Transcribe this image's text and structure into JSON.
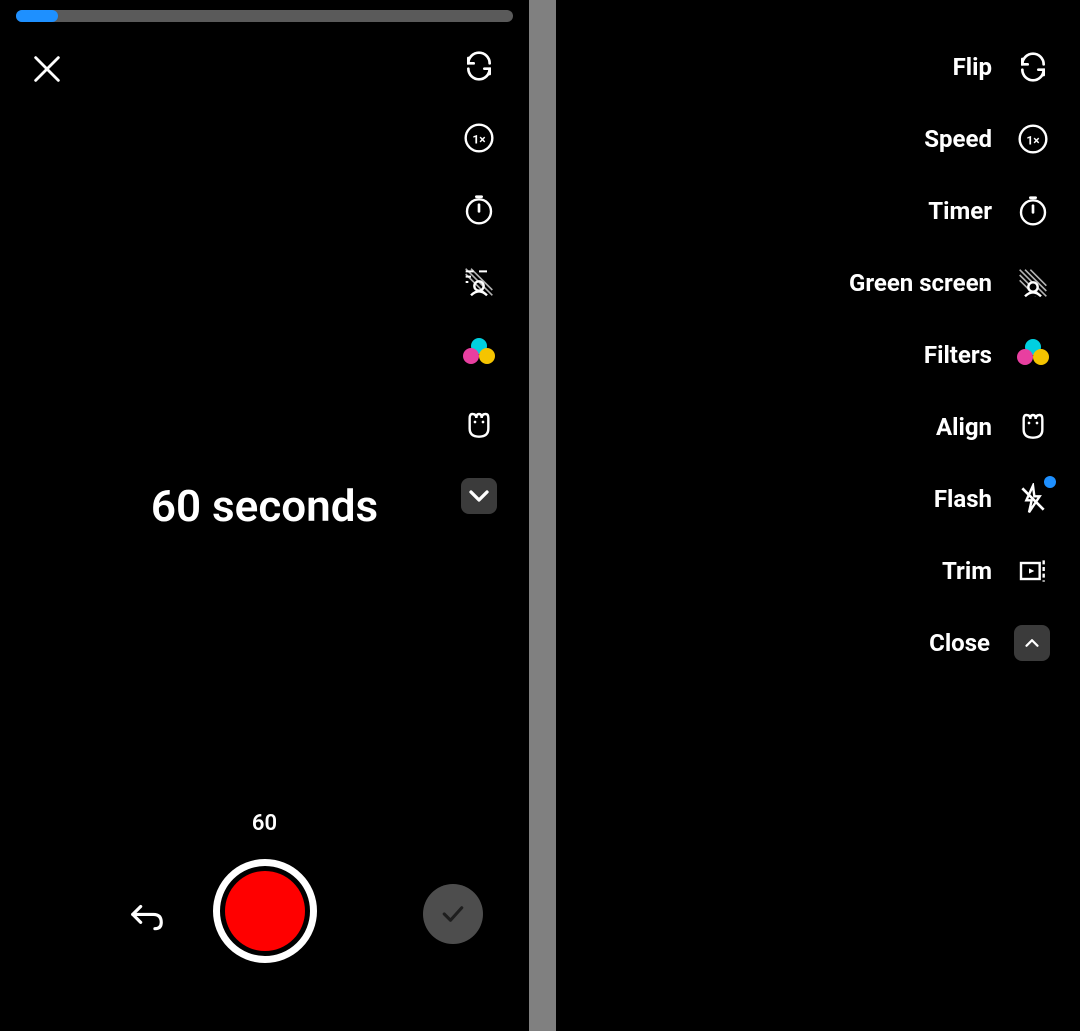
{
  "left": {
    "progress_percent": 8.5,
    "center_label": "60 seconds",
    "duration_label": "60"
  },
  "right": {
    "items": [
      {
        "label": "Flip"
      },
      {
        "label": "Speed"
      },
      {
        "label": "Timer"
      },
      {
        "label": "Green screen"
      },
      {
        "label": "Filters"
      },
      {
        "label": "Align"
      },
      {
        "label": "Flash"
      },
      {
        "label": "Trim"
      },
      {
        "label": "Close"
      }
    ]
  }
}
